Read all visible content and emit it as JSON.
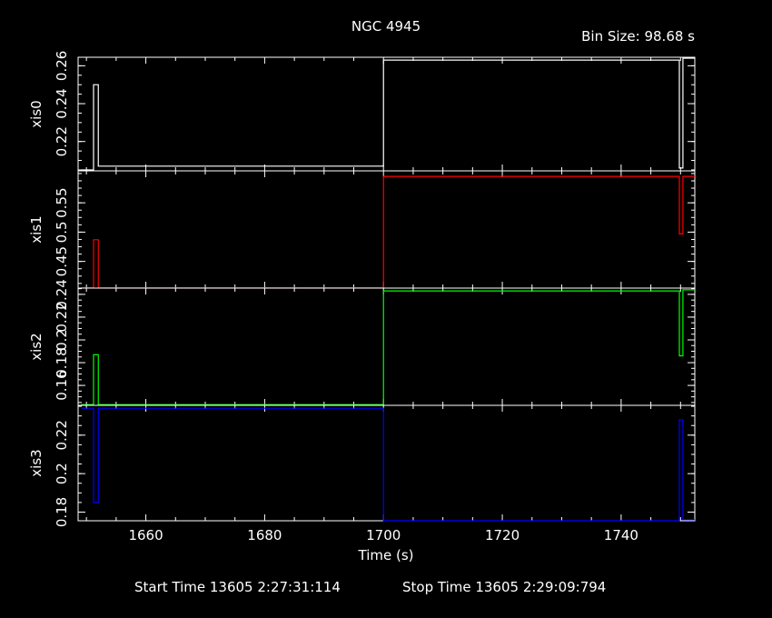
{
  "title": "NGC 4945",
  "bin_size": "Bin Size: 98.68 s",
  "footer": {
    "start": "Start Time 13605  2:27:31:114",
    "stop": "Stop Time 13605  2:29:09:794"
  },
  "colors": {
    "frame": "#ffffff",
    "xis0": "#ffffff",
    "xis1": "#ff0000",
    "xis2": "#00ff00",
    "xis3": "#0000ff"
  },
  "chart_data": {
    "type": "line",
    "xlabel": "Time (s)",
    "xlim": [
      1648.6,
      1752.4
    ],
    "x_ticks": [
      1660,
      1680,
      1700,
      1720,
      1740
    ],
    "panels": [
      {
        "name": "xis0",
        "ylabel": "xis0",
        "ylim": [
          0.2045,
          0.2645
        ],
        "y_ticks": [
          0.22,
          0.24,
          0.26
        ],
        "x": [
          1649.1,
          1650.1,
          1651.2,
          1652.0,
          1700.0,
          1749.4,
          1749.8,
          1750.4,
          1752.4
        ],
        "y": [
          0.205,
          0.205,
          0.25,
          0.207,
          0.263,
          0.263,
          0.206,
          0.264,
          0.264
        ]
      },
      {
        "name": "xis1",
        "ylabel": "xis1",
        "ylim": [
          0.4045,
          0.6045
        ],
        "y_ticks": [
          0.45,
          0.5,
          0.55
        ],
        "x": [
          1649.1,
          1650.1,
          1651.2,
          1652.0,
          1700.0,
          1749.4,
          1749.8,
          1750.4,
          1752.4
        ],
        "y": [
          0.405,
          0.405,
          0.487,
          0.405,
          0.595,
          0.595,
          0.497,
          0.595,
          0.595
        ]
      },
      {
        "name": "xis2",
        "ylabel": "xis2",
        "ylim": [
          0.1425,
          0.2455
        ],
        "y_ticks": [
          0.16,
          0.18,
          0.2,
          0.22,
          0.24
        ],
        "x": [
          1649.1,
          1650.1,
          1651.2,
          1652.0,
          1700.0,
          1749.4,
          1749.8,
          1750.4,
          1752.4
        ],
        "y": [
          0.1431,
          0.1431,
          0.187,
          0.1431,
          0.243,
          0.243,
          0.186,
          0.244,
          0.244
        ]
      },
      {
        "name": "xis3",
        "ylabel": "xis3",
        "ylim": [
          0.1755,
          0.2355
        ],
        "y_ticks": [
          0.18,
          0.2,
          0.22
        ],
        "x": [
          1649.1,
          1650.1,
          1651.2,
          1652.0,
          1700.0,
          1749.4,
          1749.8,
          1750.4,
          1752.4
        ],
        "y": [
          0.234,
          0.234,
          0.185,
          0.234,
          0.1755,
          0.1755,
          0.228,
          0.176,
          0.176
        ]
      }
    ]
  }
}
